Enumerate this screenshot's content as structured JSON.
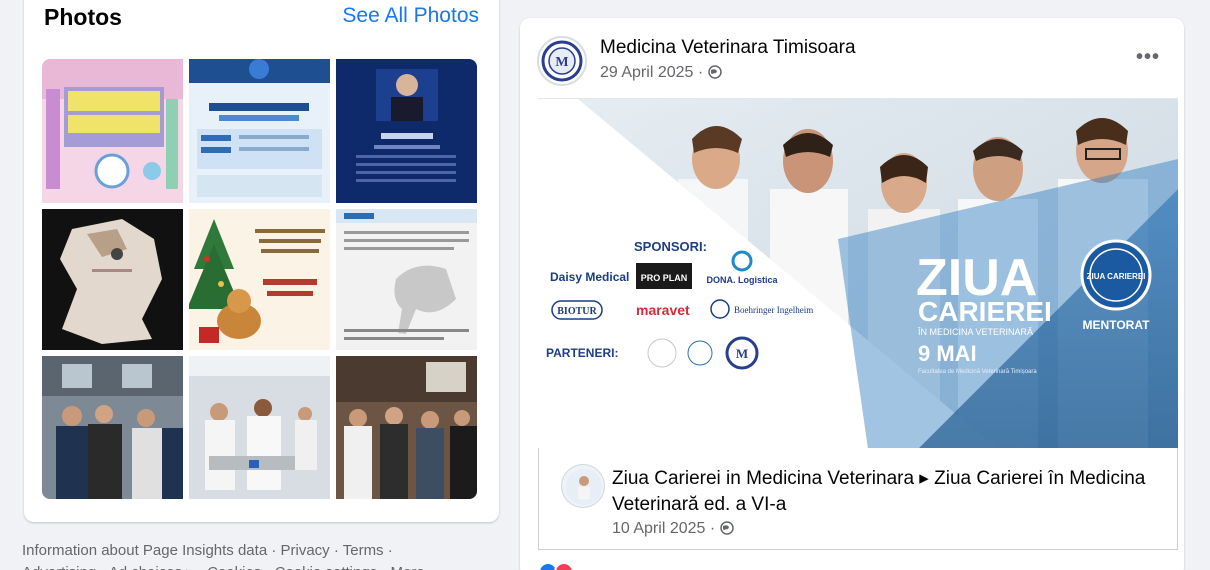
{
  "photos_card": {
    "title": "Photos",
    "see_all": "See All Photos",
    "photos": [
      {
        "name": "photo-infoafvab"
      },
      {
        "name": "photo-erasmus-mobility"
      },
      {
        "name": "photo-sorin-morariu"
      },
      {
        "name": "photo-map-plaque"
      },
      {
        "name": "photo-christmas-greeting"
      },
      {
        "name": "photo-horse-document"
      },
      {
        "name": "photo-students-lab"
      },
      {
        "name": "photo-lab-dissection"
      },
      {
        "name": "photo-students-group"
      }
    ],
    "footer_line1": "Information about Page Insights data · Privacy · Terms ·",
    "footer_line2": "Advertising · Ad choices ▸ · Cookies · Cookie settings · More"
  },
  "post": {
    "page_name": "Medicina Veterinara Timisoara",
    "date": "29 April 2025 · ",
    "more_label": "•••",
    "banner": {
      "sponsors_label": "SPONSORI:",
      "partners_label": "PARTENERI:",
      "sponsors": [
        "Daisy Medical",
        "PRO PLAN",
        "DONA. Logistica",
        "BIOTUR",
        "maravet",
        "Boehringer Ingelheim"
      ],
      "headline1": "ZIUA",
      "headline2": "CARIEREI",
      "subline": "ÎN MEDICINA VETERINARĂ",
      "date": "9 MAI",
      "location": "Facultatea de Medicină Veterinară Timișoara",
      "badge": "MENTORAT",
      "badge_seal": "ZIUA CARIEREI"
    },
    "shared": {
      "title": "Ziua Carierei in Medicina Veterinara ▸ Ziua Carierei în Medicina Veterinară ed. a VI-a",
      "date": "10 April 2025 · "
    }
  },
  "icons": {
    "globe": "globe-icon",
    "like": "like-reaction-icon",
    "love": "love-reaction-icon"
  },
  "colors": {
    "link": "#1877f2",
    "secondary_text": "#65676b",
    "banner_blue": "#1f6fb2"
  }
}
